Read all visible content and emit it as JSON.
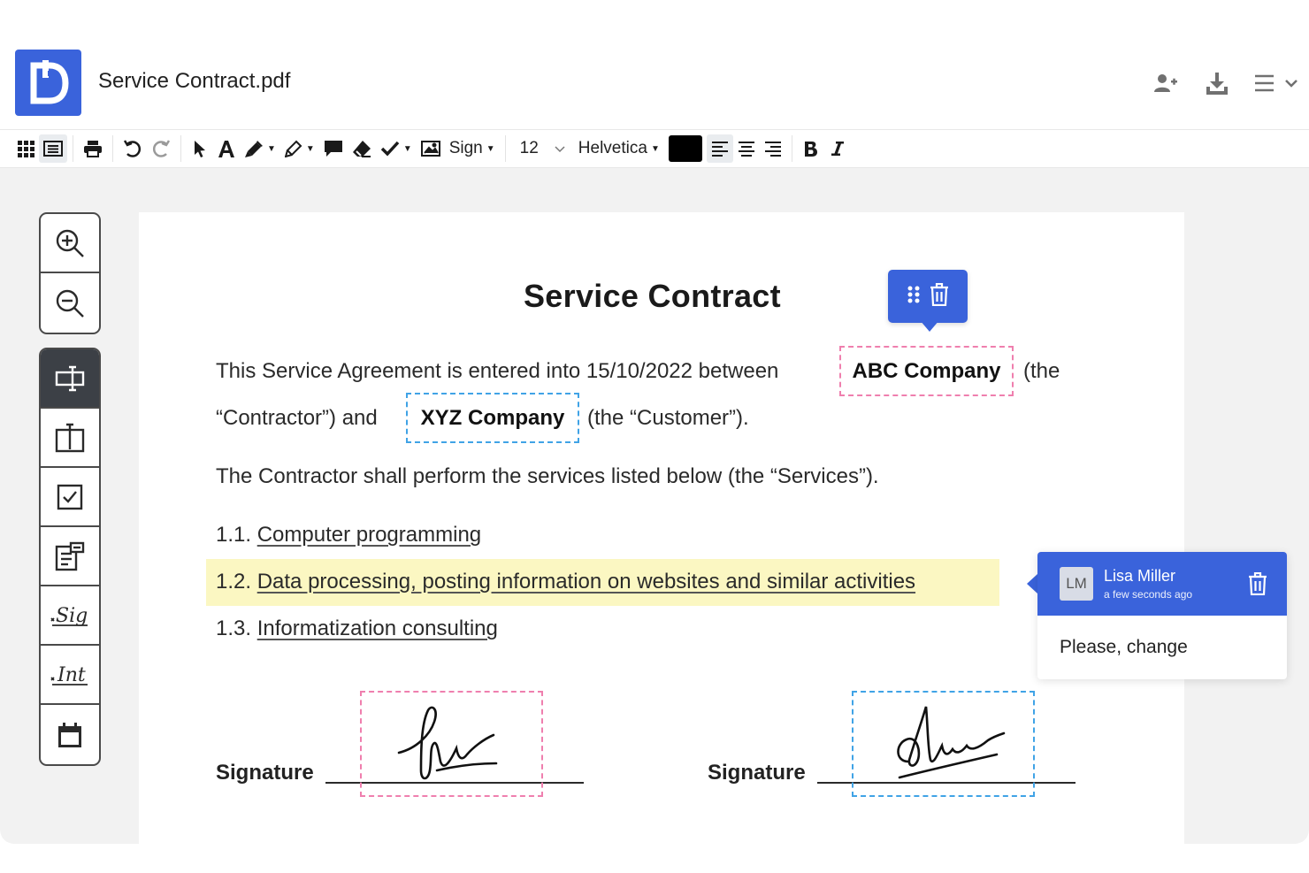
{
  "header": {
    "doc_title": "Service Contract.pdf",
    "icons": [
      "add-user-icon",
      "download-icon",
      "menu-icon"
    ]
  },
  "toolbar": {
    "sign_label": "Sign",
    "font_size": "12",
    "font_name": "Helvetica",
    "text_color": "#000000"
  },
  "document": {
    "title": "Service Contract",
    "line1_prefix": "This Service Agreement is entered into 15/10/2022 between",
    "contractor_field": "ABC Company",
    "line1_suffix": "(the",
    "line2_prefix": "“Contractor”) and",
    "customer_field": "XYZ Company",
    "line2_suffix": "(the “Customer”).",
    "services_intro": "The Contractor shall perform the services listed below (the “Services”).",
    "items": [
      {
        "num": "1.1.",
        "text": "Computer programming"
      },
      {
        "num": "1.2.",
        "text": "Data processing, posting information on websites and similar activities"
      },
      {
        "num": "1.3.",
        "text": "Informatization consulting"
      }
    ],
    "signature_label_1": "Signature",
    "signature_label_2": "Signature"
  },
  "comment": {
    "initials": "LM",
    "author": "Lisa Miller",
    "time": "a few seconds ago",
    "text": "Please, change"
  },
  "colors": {
    "accent": "#3a63db",
    "field_pink": "#ef7fae",
    "field_blue": "#40a3e6",
    "highlight": "#fbf7c2"
  }
}
